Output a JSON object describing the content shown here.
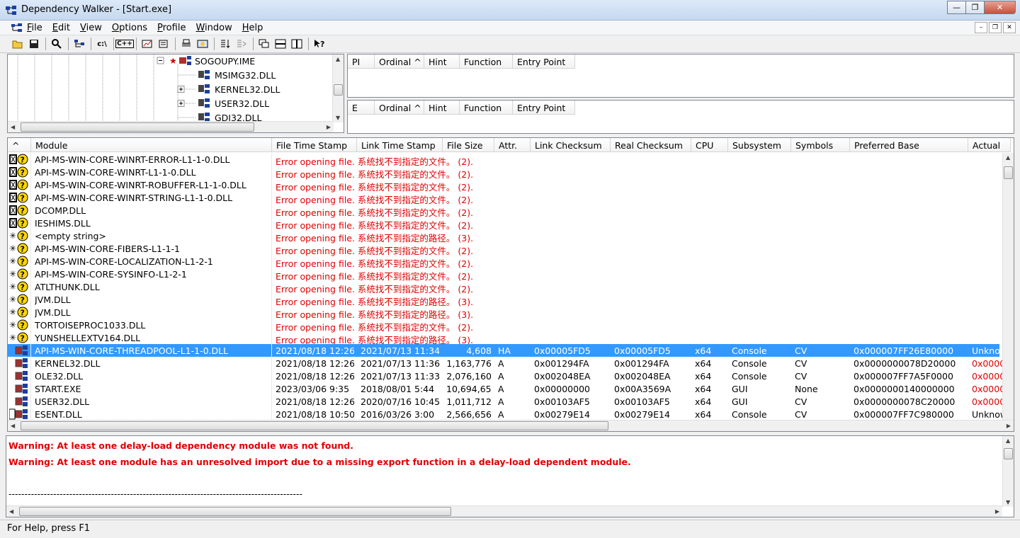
{
  "window": {
    "title": "Dependency Walker - [Start.exe]"
  },
  "menu": [
    {
      "label": "File"
    },
    {
      "label": "Edit"
    },
    {
      "label": "View"
    },
    {
      "label": "Options"
    },
    {
      "label": "Profile"
    },
    {
      "label": "Window"
    },
    {
      "label": "Help"
    }
  ],
  "tree": {
    "items": [
      {
        "label": "SOGOUPY.IME"
      },
      {
        "label": "MSIMG32.DLL"
      },
      {
        "label": "KERNEL32.DLL"
      },
      {
        "label": "USER32.DLL"
      },
      {
        "label": "GDI32.DLL"
      }
    ]
  },
  "imports_header": [
    "PI",
    "Ordinal ^",
    "Hint",
    "Function",
    "Entry Point"
  ],
  "exports_header": [
    "E",
    "Ordinal ^",
    "Hint",
    "Function",
    "Entry Point"
  ],
  "modules": {
    "columns": [
      "^",
      "Module",
      "File Time Stamp",
      "Link Time Stamp",
      "File Size",
      "Attr.",
      "Link Checksum",
      "Real Checksum",
      "CPU",
      "Subsystem",
      "Symbols",
      "Preferred Base",
      "Actual"
    ],
    "error_rows": [
      {
        "name": "API-MS-WIN-CORE-WINRT-ERROR-L1-1-0.DLL",
        "error": "Error opening file. 系统找不到指定的文件。 (2)."
      },
      {
        "name": "API-MS-WIN-CORE-WINRT-L1-1-0.DLL",
        "error": "Error opening file. 系统找不到指定的文件。 (2)."
      },
      {
        "name": "API-MS-WIN-CORE-WINRT-ROBUFFER-L1-1-0.DLL",
        "error": "Error opening file. 系统找不到指定的文件。 (2)."
      },
      {
        "name": "API-MS-WIN-CORE-WINRT-STRING-L1-1-0.DLL",
        "error": "Error opening file. 系统找不到指定的文件。 (2)."
      },
      {
        "name": "DCOMP.DLL",
        "error": "Error opening file. 系统找不到指定的文件。 (2)."
      },
      {
        "name": "IESHIMS.DLL",
        "error": "Error opening file. 系统找不到指定的文件。 (2)."
      },
      {
        "name": "<empty string>",
        "error": "Error opening file. 系统找不到指定的路径。 (3)."
      },
      {
        "name": "API-MS-WIN-CORE-FIBERS-L1-1-1",
        "error": "Error opening file. 系统找不到指定的文件。 (2)."
      },
      {
        "name": "API-MS-WIN-CORE-LOCALIZATION-L1-2-1",
        "error": "Error opening file. 系统找不到指定的文件。 (2)."
      },
      {
        "name": "API-MS-WIN-CORE-SYSINFO-L1-2-1",
        "error": "Error opening file. 系统找不到指定的文件。 (2)."
      },
      {
        "name": "ATLTHUNK.DLL",
        "error": "Error opening file. 系统找不到指定的文件。 (2)."
      },
      {
        "name": "JVM.DLL",
        "error": "Error opening file. 系统找不到指定的路径。 (3)."
      },
      {
        "name": "JVM.DLL",
        "error": "Error opening file. 系统找不到指定的路径。 (3)."
      },
      {
        "name": "TORTOISEPROC1033.DLL",
        "error": "Error opening file. 系统找不到指定的文件。 (2)."
      },
      {
        "name": "YUNSHELLEXTV164.DLL",
        "error": "Error opening file. 系统找不到指定的路径。 (3)."
      }
    ],
    "data_rows": [
      {
        "name": "API-MS-WIN-CORE-THREADPOOL-L1-1-0.DLL",
        "fts": "2021/08/18 12:26",
        "lts": "2021/07/13 11:34",
        "size": "4,608",
        "attr": "HA",
        "lchk": "0x00005FD5",
        "rchk": "0x00005FD5",
        "cpu": "x64",
        "sub": "Console",
        "sym": "CV",
        "base": "0x000007FF26E80000",
        "actual": "Unknown",
        "selected": true
      },
      {
        "name": "KERNEL32.DLL",
        "fts": "2021/08/18 12:26",
        "lts": "2021/07/13 11:36",
        "size": "1,163,776",
        "attr": "A",
        "lchk": "0x001294FA",
        "rchk": "0x001294FA",
        "cpu": "x64",
        "sub": "Console",
        "sym": "CV",
        "base": "0x0000000078D20000",
        "actual": "0x0000"
      },
      {
        "name": "OLE32.DLL",
        "fts": "2021/08/18 12:26",
        "lts": "2021/07/13 11:33",
        "size": "2,076,160",
        "attr": "A",
        "lchk": "0x002048EA",
        "rchk": "0x002048EA",
        "cpu": "x64",
        "sub": "Console",
        "sym": "CV",
        "base": "0x000007FF7A5F0000",
        "actual": "0x0000"
      },
      {
        "name": "START.EXE",
        "fts": "2023/03/06  9:35",
        "lts": "2018/08/01  5:44",
        "size": "10,694,656",
        "attr": "A",
        "lchk": "0x00000000",
        "rchk": "0x00A3569A",
        "cpu": "x64",
        "sub": "GUI",
        "sym": "None",
        "base": "0x0000000140000000",
        "actual": "0x0000"
      },
      {
        "name": "USER32.DLL",
        "fts": "2021/08/18 12:26",
        "lts": "2020/07/16 10:45",
        "size": "1,011,712",
        "attr": "A",
        "lchk": "0x00103AF5",
        "rchk": "0x00103AF5",
        "cpu": "x64",
        "sub": "GUI",
        "sym": "CV",
        "base": "0x0000000078C20000",
        "actual": "0x0000"
      },
      {
        "name": "ESENT.DLL",
        "fts": "2021/08/18 10:50",
        "lts": "2016/03/26  3:00",
        "size": "2,566,656",
        "attr": "A",
        "lchk": "0x00279E14",
        "rchk": "0x00279E14",
        "cpu": "x64",
        "sub": "Console",
        "sym": "CV",
        "base": "0x000007FF7C980000",
        "actual": "Unknown"
      }
    ]
  },
  "log": {
    "warnings": [
      "Warning: At least one delay-load dependency module was not found.",
      "Warning: At least one module has an unresolved import due to a missing export function in a delay-load dependent module."
    ],
    "separator": "--------------------------------------------------------------------------------------------"
  },
  "status": {
    "text": "For Help, press F1"
  },
  "colors": {
    "error": "#e00000",
    "selection": "#3399ff"
  }
}
